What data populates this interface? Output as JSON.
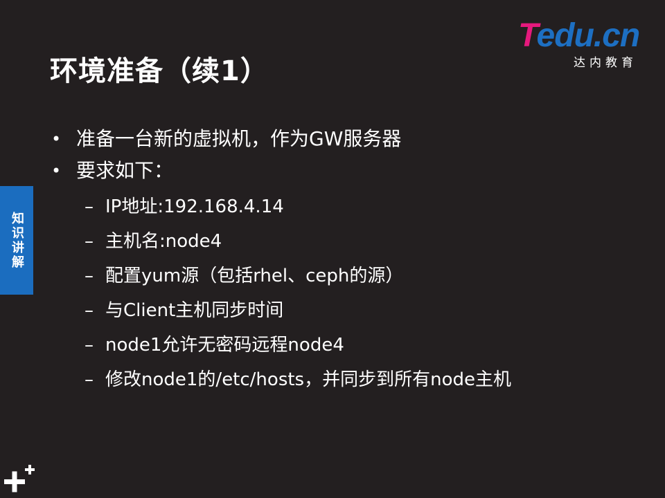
{
  "slide": {
    "title": "环境准备（续1）",
    "logo": {
      "brand_t": "T",
      "brand_rest": "edu.cn",
      "subtitle": "达内教育"
    },
    "side_tab": {
      "label": "知识讲解"
    },
    "bullets": [
      {
        "marker": "•",
        "text": "准备一台新的虚拟机，作为GW服务器"
      },
      {
        "marker": "•",
        "text": "要求如下："
      }
    ],
    "sub_bullets": [
      {
        "marker": "–",
        "text": "IP地址:192.168.4.14"
      },
      {
        "marker": "–",
        "text": "主机名:node4"
      },
      {
        "marker": "–",
        "text": "配置yum源（包括rhel、ceph的源）"
      },
      {
        "marker": "–",
        "text": "与Client主机同步时间"
      },
      {
        "marker": "–",
        "text": "node1允许无密码远程node4"
      },
      {
        "marker": "–",
        "text": "修改node1的/etc/hosts，并同步到所有node主机"
      }
    ]
  },
  "colors": {
    "background": "#231f20",
    "text": "#ffffff",
    "side_tab": "#1b6dbf",
    "logo_pink": "#e5197d",
    "logo_blue": "#1d6fc2"
  },
  "icons": {
    "corner": "plus-icon"
  }
}
